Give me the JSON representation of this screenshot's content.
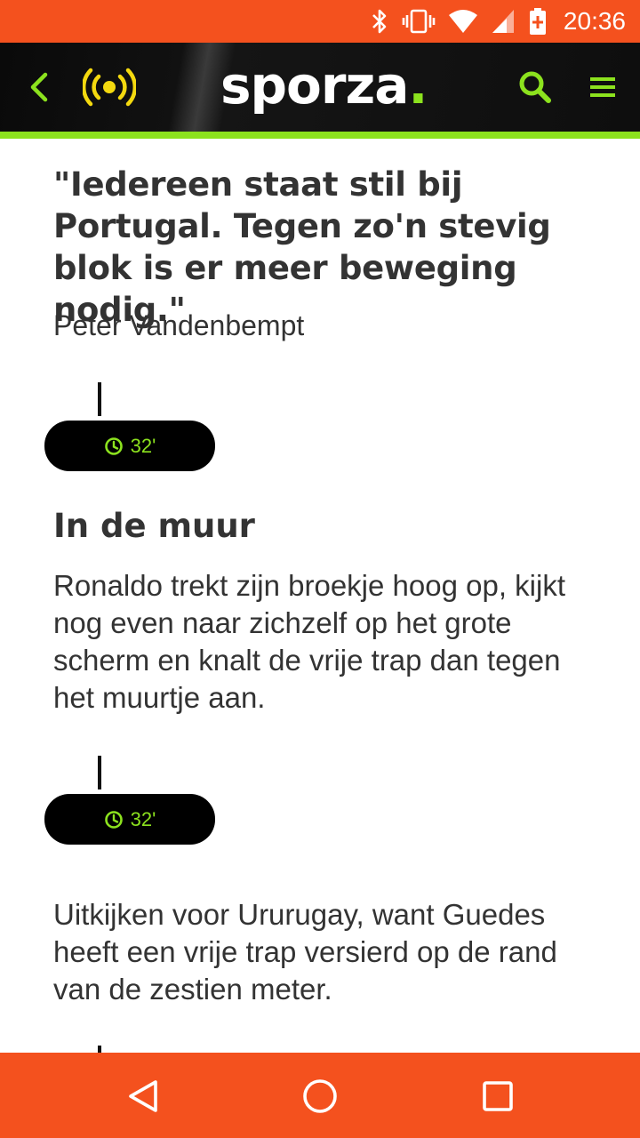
{
  "status_bar": {
    "time": "20:36",
    "icons": [
      "bluetooth-icon",
      "vibrate-icon",
      "wifi-icon",
      "signal-icon",
      "battery-charging-icon"
    ],
    "color": "#f4511e"
  },
  "app_bar": {
    "logo_text": "sporza",
    "logo_dot": ".",
    "back_icon": "chevron-left-icon",
    "live_icon": "live-broadcast-icon",
    "search_icon": "search-icon",
    "menu_icon": "hamburger-menu-icon",
    "accent_color": "#8ce21e",
    "live_color": "#f4d90f"
  },
  "article": {
    "quote": "\"Iedereen staat stil bij Portugal. Tegen zo'n stevig blok is er meer beweging nodig.\"",
    "quote_author": "Peter Vandenbempt",
    "posts": [
      {
        "time": "32'",
        "title": "In de muur",
        "body": "Ronaldo trekt zijn broekje hoog op, kijkt nog even naar zichzelf op het grote scherm en knalt de vrije trap dan tegen het muurtje aan."
      },
      {
        "time": "32'",
        "title": "",
        "body": "Uitkijken voor Ururugay, want Guedes heeft een vrije trap versierd op de rand van de zestien meter."
      }
    ]
  },
  "nav_bar": {
    "icons": [
      "back-triangle-icon",
      "home-circle-icon",
      "recent-apps-square-icon"
    ],
    "color": "#f4511e"
  }
}
